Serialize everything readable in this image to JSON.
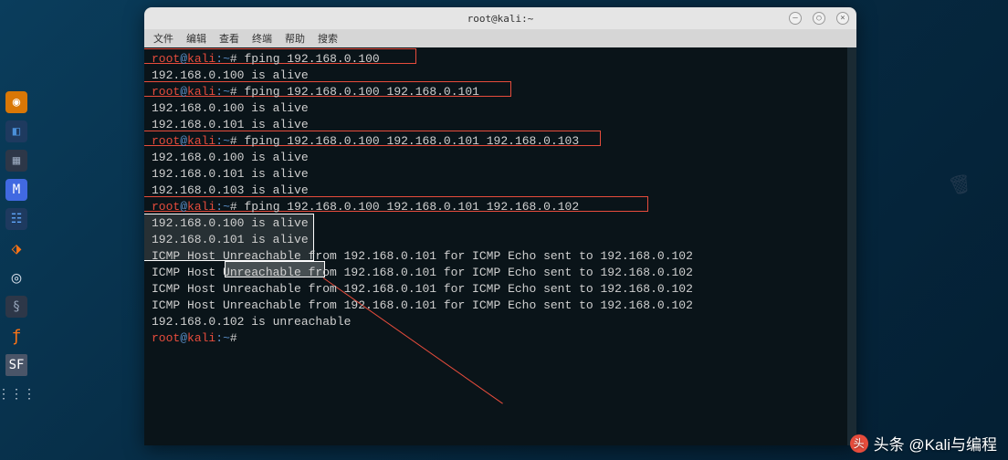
{
  "window": {
    "title": "root@kali:~"
  },
  "menubar": {
    "items": [
      "文件",
      "编辑",
      "查看",
      "终端",
      "帮助",
      "搜索"
    ]
  },
  "prompt": {
    "user": "root",
    "at": "@",
    "host": "kali",
    "colon": ":",
    "path": "~",
    "hash": "#"
  },
  "commands": {
    "c1": "fping 192.168.0.100",
    "c2": "fping 192.168.0.100 192.168.0.101",
    "c3": "fping 192.168.0.100 192.168.0.101 192.168.0.103",
    "c4": "fping 192.168.0.100 192.168.0.101 192.168.0.102",
    "c5": ""
  },
  "output": {
    "o1": "192.168.0.100 is alive",
    "o2": "192.168.0.100 is alive",
    "o3": "192.168.0.101 is alive",
    "o4": "192.168.0.100 is alive",
    "o5": "192.168.0.101 is alive",
    "o6": "192.168.0.103 is alive",
    "o7": "192.168.0.100 is alive",
    "o8": "192.168.0.101 is alive",
    "u1": "ICMP Host Unreachable from 192.168.0.101 for ICMP Echo sent to 192.168.0.102",
    "u2": "ICMP Host Unreachable from 192.168.0.101 for ICMP Echo sent to 192.168.0.102",
    "u3": "ICMP Host Unreachable from 192.168.0.101 for ICMP Echo sent to 192.168.0.102",
    "u4": "ICMP Host Unreachable from 192.168.0.101 for ICMP Echo sent to 192.168.0.102",
    "o9": "192.168.0.102 is unreachable"
  },
  "watermark": {
    "text": "头条 @Kali与编程"
  },
  "dock": {
    "i1": "◉",
    "i2": "◧",
    "i3": "▦",
    "i4": "M",
    "i5": "☷",
    "i6": "⬗",
    "i7": "◎",
    "i8": "§",
    "i9": "ƒ",
    "i10": "SF",
    "i11": "⋮⋮⋮"
  },
  "titlebar_btns": {
    "min": "–",
    "max": "○",
    "close": "×"
  }
}
